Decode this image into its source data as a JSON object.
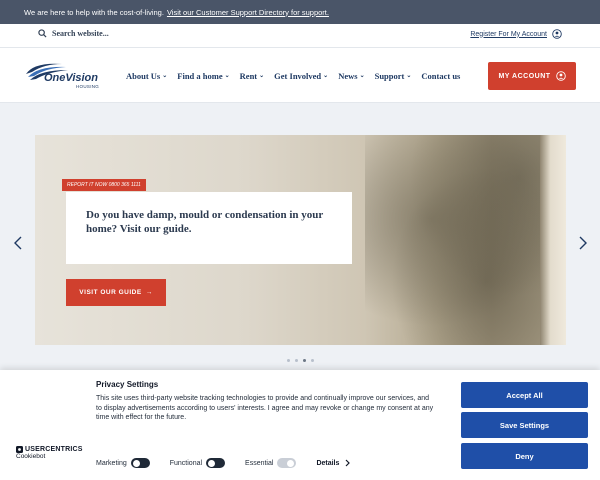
{
  "topbar": {
    "message": "We are here to help with the cost-of-living.",
    "link": "Visit our Customer Support Directory for support."
  },
  "search": {
    "label": "Search website..."
  },
  "account": {
    "register": "Register For My Account",
    "my_account": "MY ACCOUNT"
  },
  "logo": {
    "main": "OneVision",
    "sub": "HOUSING"
  },
  "nav": {
    "about": "About Us",
    "find": "Find a home",
    "rent": "Rent",
    "involved": "Get Involved",
    "news": "News",
    "support": "Support",
    "contact": "Contact us",
    "chevron": "⌄"
  },
  "hero": {
    "tag": "REPORT IT NOW 0800 365 1111",
    "title": "Do you have damp, mould or condensation in your home? Visit our guide.",
    "button": "VISIT OUR GUIDE",
    "button_arrow": "→"
  },
  "consent": {
    "title": "Privacy Settings",
    "text": "This site uses third-party website tracking technologies to provide and continually improve our services, and to display advertisements according to users' interests. I agree and may revoke or change my consent at any time with effect for the future.",
    "brand_main": "USERCENTRICS",
    "brand_sub": "Cookiebot",
    "marketing": "Marketing",
    "functional": "Functional",
    "essential": "Essential",
    "details": "Details",
    "accept": "Accept All",
    "save": "Save Settings",
    "deny": "Deny"
  },
  "colors": {
    "accent_red": "#d0402e",
    "brand_navy": "#1f3a63",
    "consent_blue": "#1f4fa8",
    "topbar_bg": "#4a5568"
  }
}
